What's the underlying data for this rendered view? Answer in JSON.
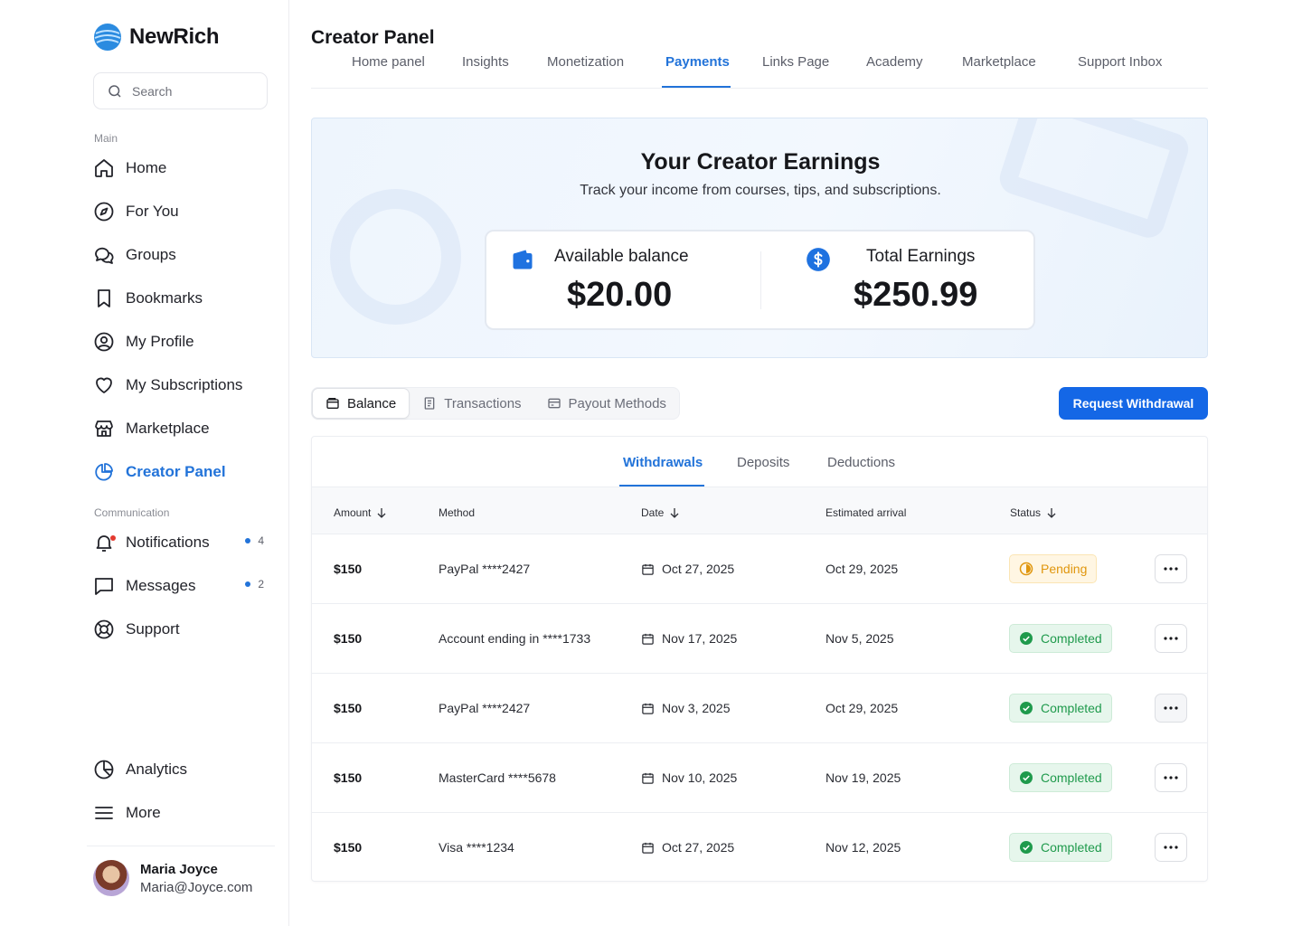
{
  "brand": {
    "name": "NewRich"
  },
  "search": {
    "placeholder": "Search"
  },
  "sidebar": {
    "main_label": "Main",
    "communication_label": "Communication",
    "items": [
      {
        "label": "Home",
        "icon": "home-icon"
      },
      {
        "label": "For You",
        "icon": "compass-icon"
      },
      {
        "label": "Groups",
        "icon": "groups-icon"
      },
      {
        "label": "Bookmarks",
        "icon": "bookmark-icon"
      },
      {
        "label": "My Profile",
        "icon": "user-circle-icon"
      },
      {
        "label": "My Subscriptions",
        "icon": "heart-icon"
      },
      {
        "label": "Marketplace",
        "icon": "store-icon"
      },
      {
        "label": "Creator Panel",
        "icon": "pie-chart-icon",
        "active": true
      }
    ],
    "comm_items": [
      {
        "label": "Notifications",
        "icon": "bell-icon",
        "count": "4"
      },
      {
        "label": "Messages",
        "icon": "message-icon",
        "count": "2"
      },
      {
        "label": "Support",
        "icon": "lifebuoy-icon"
      }
    ],
    "bottom_items": [
      {
        "label": "Analytics",
        "icon": "analytics-icon"
      },
      {
        "label": "More",
        "icon": "menu-icon"
      }
    ]
  },
  "user": {
    "name": "Maria Joyce",
    "email": "Maria@Joyce.com"
  },
  "header": {
    "title": "Creator Panel",
    "tabs": [
      "Home panel",
      "Insights",
      "Monetization",
      "Payments",
      "Links Page",
      "Academy",
      "Marketplace",
      "Support Inbox"
    ],
    "active_tab": "Payments"
  },
  "earnings": {
    "title": "Your Creator Earnings",
    "subtitle": "Track your income from courses, tips, and subscriptions.",
    "available_label": "Available balance",
    "available_value": "$20.00",
    "total_label": "Total Earnings",
    "total_value": "$250.99"
  },
  "segments": [
    "Balance",
    "Transactions",
    "Payout Methods"
  ],
  "request_button": "Request Withdrawal",
  "subtabs": [
    "Withdrawals",
    "Deposits",
    "Deductions"
  ],
  "table": {
    "columns": [
      "Amount",
      "Method",
      "Date",
      "Estimated arrival",
      "Status"
    ],
    "rows": [
      {
        "amount": "$150",
        "method": "PayPal ****2427",
        "date": "Oct 27, 2025",
        "arrival": "Oct 29, 2025",
        "status": "Pending"
      },
      {
        "amount": "$150",
        "method": "Account ending in ****1733",
        "date": "Nov 17, 2025",
        "arrival": "Nov 5, 2025",
        "status": "Completed"
      },
      {
        "amount": "$150",
        "method": "PayPal ****2427",
        "date": "Nov 3, 2025",
        "arrival": "Oct 29, 2025",
        "status": "Completed"
      },
      {
        "amount": "$150",
        "method": "MasterCard ****5678",
        "date": "Nov 10, 2025",
        "arrival": "Nov 19, 2025",
        "status": "Completed"
      },
      {
        "amount": "$150",
        "method": "Visa ****1234",
        "date": "Oct 27, 2025",
        "arrival": "Nov 12, 2025",
        "status": "Completed"
      }
    ]
  },
  "colors": {
    "accent": "#2273d9",
    "button": "#1467e6",
    "pending": "#e0960d",
    "completed": "#1f9a4c"
  }
}
